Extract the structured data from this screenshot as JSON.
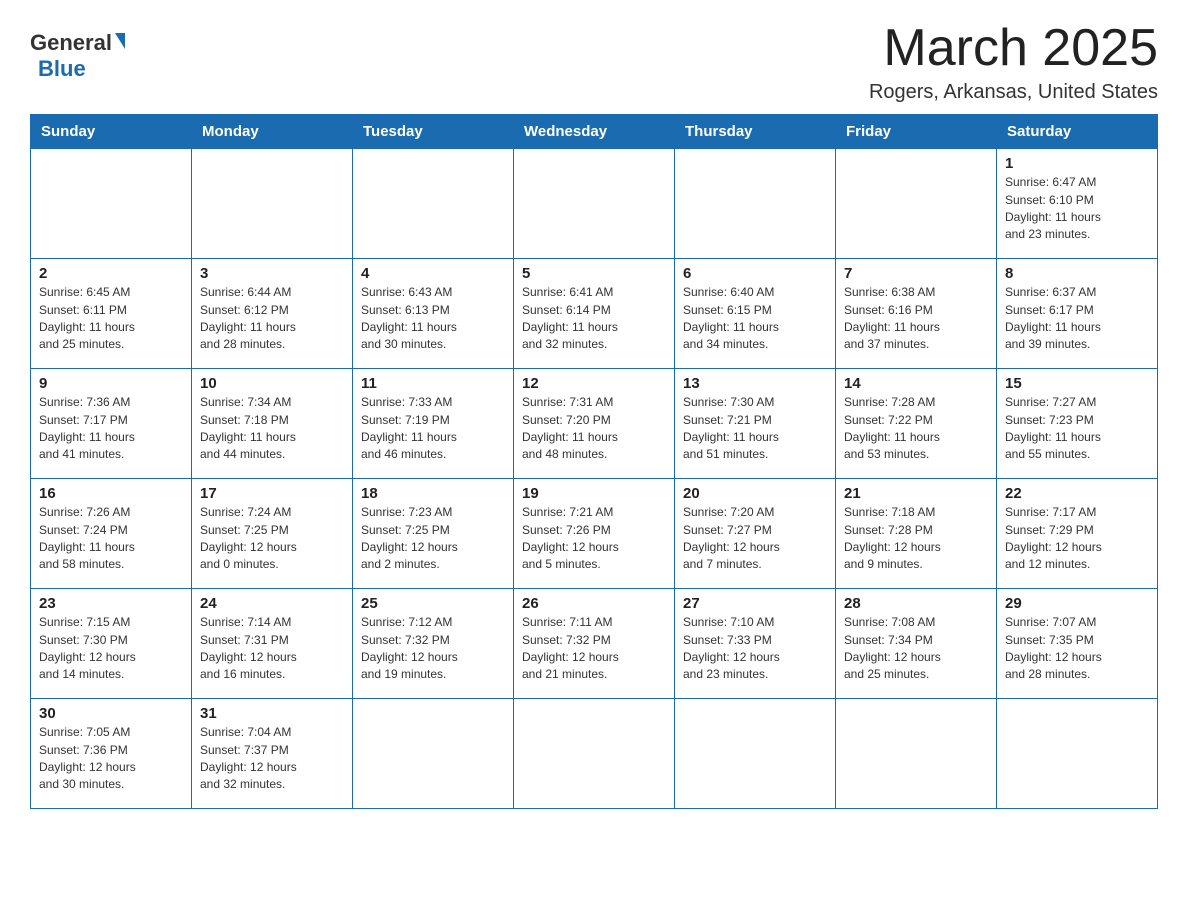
{
  "logo": {
    "general": "General",
    "blue": "Blue"
  },
  "title": "March 2025",
  "subtitle": "Rogers, Arkansas, United States",
  "headers": [
    "Sunday",
    "Monday",
    "Tuesday",
    "Wednesday",
    "Thursday",
    "Friday",
    "Saturday"
  ],
  "weeks": [
    [
      {
        "day": "",
        "info": ""
      },
      {
        "day": "",
        "info": ""
      },
      {
        "day": "",
        "info": ""
      },
      {
        "day": "",
        "info": ""
      },
      {
        "day": "",
        "info": ""
      },
      {
        "day": "",
        "info": ""
      },
      {
        "day": "1",
        "info": "Sunrise: 6:47 AM\nSunset: 6:10 PM\nDaylight: 11 hours\nand 23 minutes."
      }
    ],
    [
      {
        "day": "2",
        "info": "Sunrise: 6:45 AM\nSunset: 6:11 PM\nDaylight: 11 hours\nand 25 minutes."
      },
      {
        "day": "3",
        "info": "Sunrise: 6:44 AM\nSunset: 6:12 PM\nDaylight: 11 hours\nand 28 minutes."
      },
      {
        "day": "4",
        "info": "Sunrise: 6:43 AM\nSunset: 6:13 PM\nDaylight: 11 hours\nand 30 minutes."
      },
      {
        "day": "5",
        "info": "Sunrise: 6:41 AM\nSunset: 6:14 PM\nDaylight: 11 hours\nand 32 minutes."
      },
      {
        "day": "6",
        "info": "Sunrise: 6:40 AM\nSunset: 6:15 PM\nDaylight: 11 hours\nand 34 minutes."
      },
      {
        "day": "7",
        "info": "Sunrise: 6:38 AM\nSunset: 6:16 PM\nDaylight: 11 hours\nand 37 minutes."
      },
      {
        "day": "8",
        "info": "Sunrise: 6:37 AM\nSunset: 6:17 PM\nDaylight: 11 hours\nand 39 minutes."
      }
    ],
    [
      {
        "day": "9",
        "info": "Sunrise: 7:36 AM\nSunset: 7:17 PM\nDaylight: 11 hours\nand 41 minutes."
      },
      {
        "day": "10",
        "info": "Sunrise: 7:34 AM\nSunset: 7:18 PM\nDaylight: 11 hours\nand 44 minutes."
      },
      {
        "day": "11",
        "info": "Sunrise: 7:33 AM\nSunset: 7:19 PM\nDaylight: 11 hours\nand 46 minutes."
      },
      {
        "day": "12",
        "info": "Sunrise: 7:31 AM\nSunset: 7:20 PM\nDaylight: 11 hours\nand 48 minutes."
      },
      {
        "day": "13",
        "info": "Sunrise: 7:30 AM\nSunset: 7:21 PM\nDaylight: 11 hours\nand 51 minutes."
      },
      {
        "day": "14",
        "info": "Sunrise: 7:28 AM\nSunset: 7:22 PM\nDaylight: 11 hours\nand 53 minutes."
      },
      {
        "day": "15",
        "info": "Sunrise: 7:27 AM\nSunset: 7:23 PM\nDaylight: 11 hours\nand 55 minutes."
      }
    ],
    [
      {
        "day": "16",
        "info": "Sunrise: 7:26 AM\nSunset: 7:24 PM\nDaylight: 11 hours\nand 58 minutes."
      },
      {
        "day": "17",
        "info": "Sunrise: 7:24 AM\nSunset: 7:25 PM\nDaylight: 12 hours\nand 0 minutes."
      },
      {
        "day": "18",
        "info": "Sunrise: 7:23 AM\nSunset: 7:25 PM\nDaylight: 12 hours\nand 2 minutes."
      },
      {
        "day": "19",
        "info": "Sunrise: 7:21 AM\nSunset: 7:26 PM\nDaylight: 12 hours\nand 5 minutes."
      },
      {
        "day": "20",
        "info": "Sunrise: 7:20 AM\nSunset: 7:27 PM\nDaylight: 12 hours\nand 7 minutes."
      },
      {
        "day": "21",
        "info": "Sunrise: 7:18 AM\nSunset: 7:28 PM\nDaylight: 12 hours\nand 9 minutes."
      },
      {
        "day": "22",
        "info": "Sunrise: 7:17 AM\nSunset: 7:29 PM\nDaylight: 12 hours\nand 12 minutes."
      }
    ],
    [
      {
        "day": "23",
        "info": "Sunrise: 7:15 AM\nSunset: 7:30 PM\nDaylight: 12 hours\nand 14 minutes."
      },
      {
        "day": "24",
        "info": "Sunrise: 7:14 AM\nSunset: 7:31 PM\nDaylight: 12 hours\nand 16 minutes."
      },
      {
        "day": "25",
        "info": "Sunrise: 7:12 AM\nSunset: 7:32 PM\nDaylight: 12 hours\nand 19 minutes."
      },
      {
        "day": "26",
        "info": "Sunrise: 7:11 AM\nSunset: 7:32 PM\nDaylight: 12 hours\nand 21 minutes."
      },
      {
        "day": "27",
        "info": "Sunrise: 7:10 AM\nSunset: 7:33 PM\nDaylight: 12 hours\nand 23 minutes."
      },
      {
        "day": "28",
        "info": "Sunrise: 7:08 AM\nSunset: 7:34 PM\nDaylight: 12 hours\nand 25 minutes."
      },
      {
        "day": "29",
        "info": "Sunrise: 7:07 AM\nSunset: 7:35 PM\nDaylight: 12 hours\nand 28 minutes."
      }
    ],
    [
      {
        "day": "30",
        "info": "Sunrise: 7:05 AM\nSunset: 7:36 PM\nDaylight: 12 hours\nand 30 minutes."
      },
      {
        "day": "31",
        "info": "Sunrise: 7:04 AM\nSunset: 7:37 PM\nDaylight: 12 hours\nand 32 minutes."
      },
      {
        "day": "",
        "info": ""
      },
      {
        "day": "",
        "info": ""
      },
      {
        "day": "",
        "info": ""
      },
      {
        "day": "",
        "info": ""
      },
      {
        "day": "",
        "info": ""
      }
    ]
  ]
}
